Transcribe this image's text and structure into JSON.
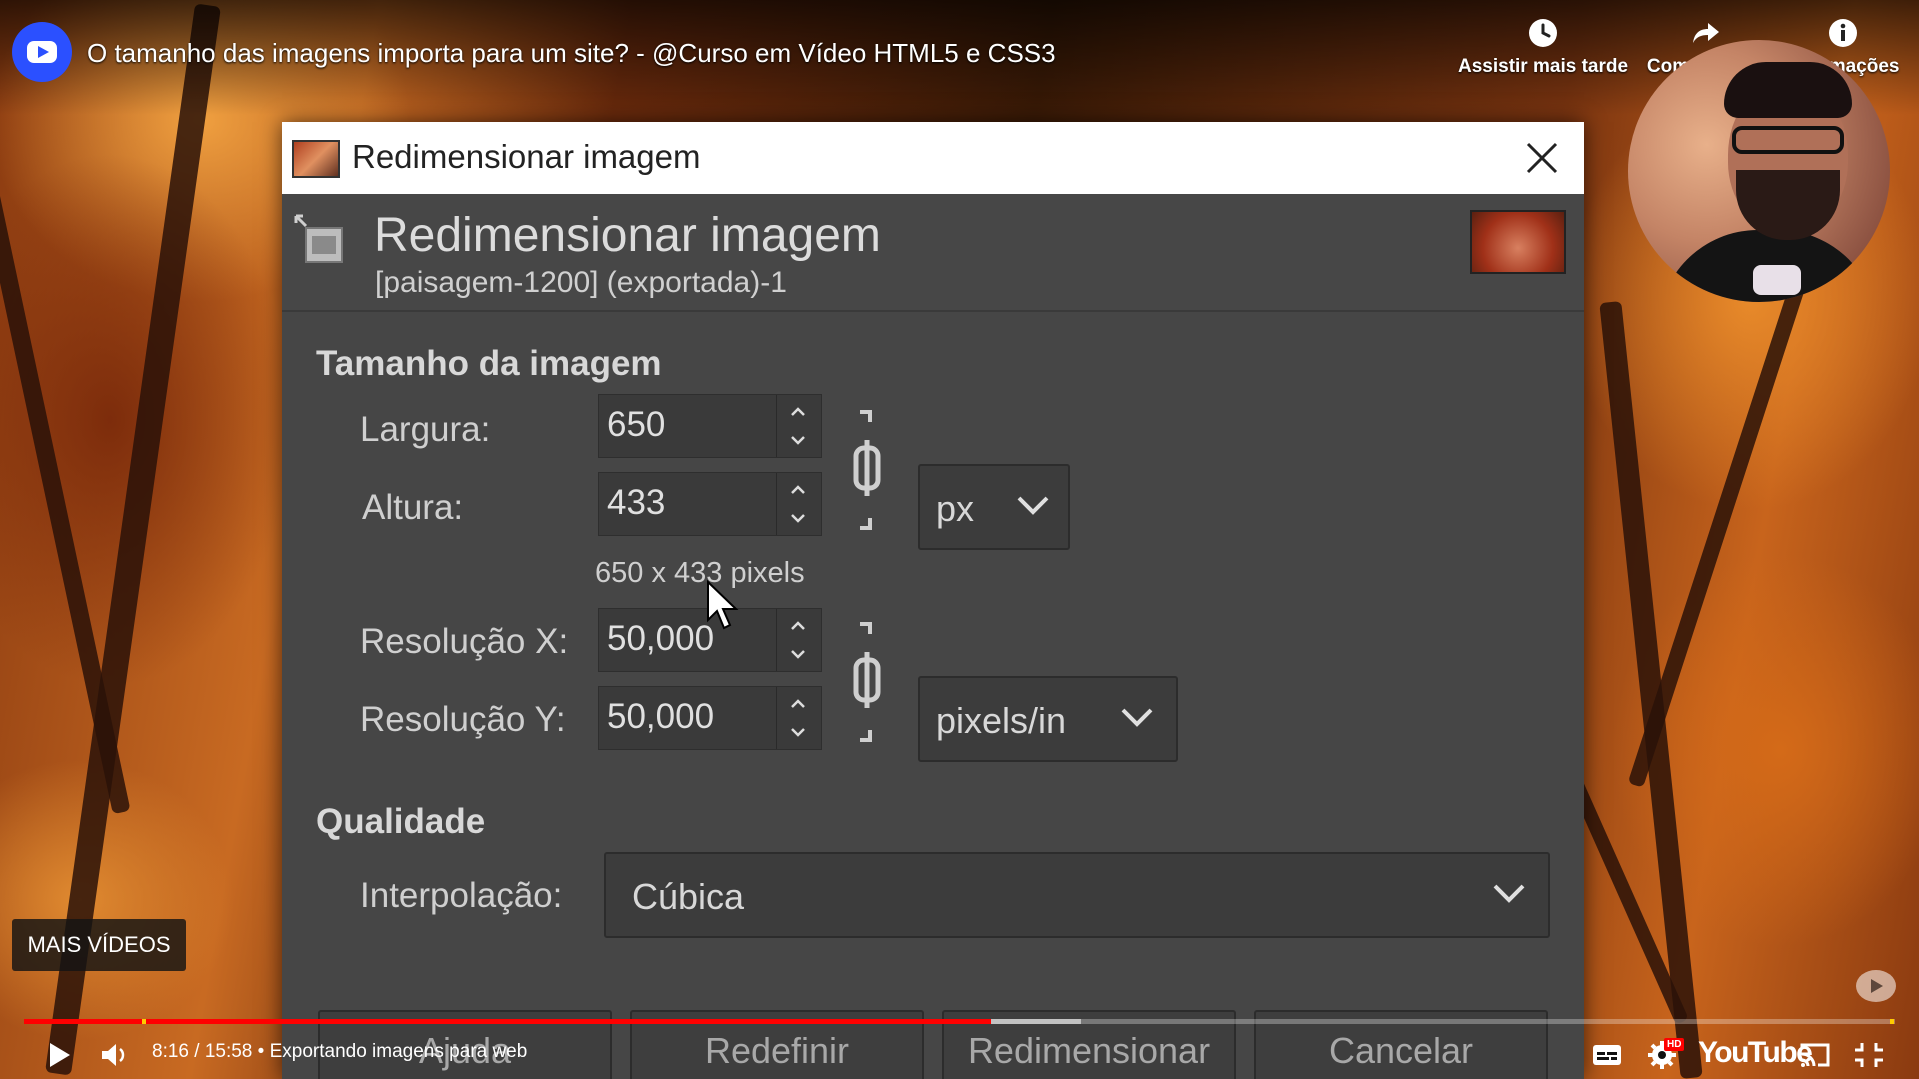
{
  "player": {
    "video_title": "O tamanho das imagens importa para um site? - @Curso em Vídeo HTML5 e CSS3",
    "actions": {
      "watch_later": "Assistir mais tarde",
      "share": "Compartilhar",
      "info": "Informações"
    },
    "more_videos": "MAIS VÍDEOS",
    "time_display": "8:16 / 15:58",
    "separator": " • ",
    "chapter": "Exportando imagens para web",
    "progress_fraction": 0.517,
    "buffer_fraction": 0.565,
    "brand_text": "YouTube",
    "hd_badge": "HD",
    "accent_color": "#ff0000"
  },
  "dialog": {
    "window_title": "Redimensionar imagem",
    "header_title": "Redimensionar imagem",
    "header_subtitle": "[paisagem-1200] (exportada)-1",
    "size_section": "Tamanho da imagem",
    "width_label": "Largura:",
    "width_value": "650",
    "height_label": "Altura:",
    "height_value": "433",
    "unit_value": "px",
    "pixel_info": "650 x 433 pixels",
    "res_x_label": "Resolução X:",
    "res_x_value": "50,000",
    "res_y_label": "Resolução Y:",
    "res_y_value": "50,000",
    "res_unit_value": "pixels/in",
    "quality_section": "Qualidade",
    "interpolation_label": "Interpolação:",
    "interpolation_value": "Cúbica",
    "buttons": {
      "help": "Ajuda",
      "reset": "Redefinir",
      "resize": "Redimensionar",
      "cancel": "Cancelar"
    }
  }
}
